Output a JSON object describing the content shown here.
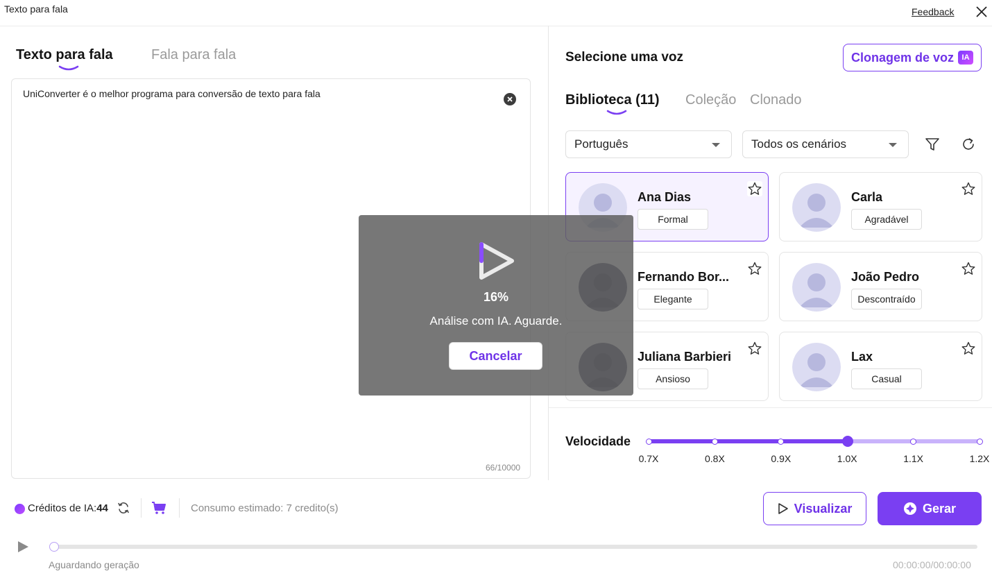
{
  "window": {
    "title": "Texto para fala",
    "feedback": "Feedback"
  },
  "left": {
    "tabs": [
      {
        "label": "Texto para fala"
      },
      {
        "label": "Fala para fala"
      }
    ],
    "text": "UniConverter é o melhor programa para conversão de texto para fala",
    "char_count": "66/10000"
  },
  "right": {
    "title": "Selecione uma voz",
    "clone_button": "Clonagem de voz",
    "clone_badge": "IA",
    "library_tabs": [
      {
        "label": "Biblioteca (11)"
      },
      {
        "label": "Coleção"
      },
      {
        "label": "Clonado"
      }
    ],
    "language_select": "Português",
    "scenario_select": "Todos os cenários",
    "voices": [
      {
        "name": "Ana Dias",
        "tag": "Formal",
        "selected": true,
        "tone": "light"
      },
      {
        "name": "Carla",
        "tag": "Agradável",
        "selected": false,
        "tone": "light"
      },
      {
        "name": "Fernando Bor...",
        "tag": "Elegante",
        "selected": false,
        "tone": "dark"
      },
      {
        "name": "João Pedro",
        "tag": "Descontraído",
        "selected": false,
        "tone": "light"
      },
      {
        "name": "Juliana Barbieri",
        "tag": "Ansioso",
        "selected": false,
        "tone": "dark"
      },
      {
        "name": "Lax",
        "tag": "Casual",
        "selected": false,
        "tone": "light"
      }
    ],
    "speed": {
      "label": "Velocidade",
      "ticks": [
        "0.7X",
        "0.8X",
        "0.9X",
        "1.0X",
        "1.1X",
        "1.2X"
      ],
      "selected": "1.0X"
    }
  },
  "bottom": {
    "credits_label": "Créditos de IA:",
    "credits_value": "44",
    "consumption": "Consumo estimado: 7 credito(s)",
    "preview_button": "Visualizar",
    "generate_button": "Gerar",
    "status": "Aguardando geração",
    "time": "00:00:00/00:00:00"
  },
  "overlay": {
    "percent": "16%",
    "message": "Análise com IA. Aguarde.",
    "cancel": "Cancelar"
  },
  "colors": {
    "accent": "#7a3ff2",
    "accent_light": "#c9b3fb",
    "overlay": "#5f5f5f"
  }
}
